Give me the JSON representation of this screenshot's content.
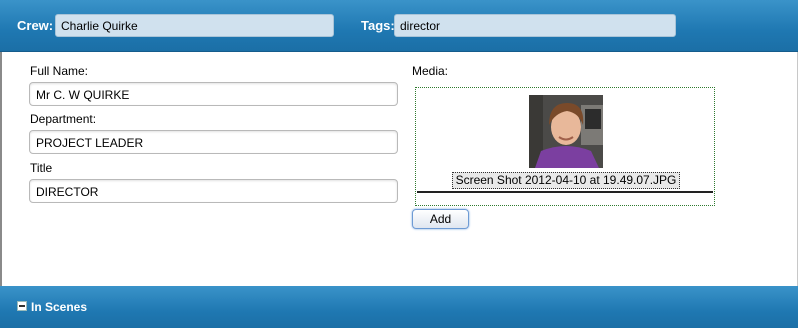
{
  "header": {
    "crew_label": "Crew:",
    "crew_value": "Charlie Quirke",
    "tags_label": "Tags:",
    "tags_value": "director"
  },
  "form": {
    "full_name_label": "Full Name:",
    "full_name_value": "Mr C. W QUIRKE",
    "department_label": "Department:",
    "department_value": "PROJECT LEADER",
    "title_label": "Title",
    "title_value": "DIRECTOR"
  },
  "media": {
    "label": "Media:",
    "caption": "Screen Shot 2012-04-10 at 19.49.07.JPG",
    "add_label": "Add"
  },
  "section": {
    "title": "In Scenes"
  },
  "colors": {
    "header_blue": "#2a86c0",
    "field_bg": "#d0e1ee",
    "media_border": "#2f7a2f"
  }
}
